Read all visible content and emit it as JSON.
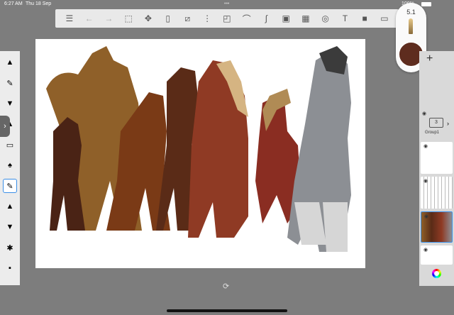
{
  "status": {
    "time": "6:27 AM",
    "date": "Thu 18 Sep",
    "battery": "100%"
  },
  "toolbar": {
    "tools": [
      {
        "name": "layers-list-icon",
        "glyph": "☰",
        "disabled": false
      },
      {
        "name": "undo-icon",
        "glyph": "←",
        "disabled": true
      },
      {
        "name": "redo-icon",
        "glyph": "→",
        "disabled": true
      },
      {
        "name": "selection-icon",
        "glyph": "⬚",
        "disabled": false
      },
      {
        "name": "move-icon",
        "glyph": "✥",
        "disabled": false
      },
      {
        "name": "fill-icon",
        "glyph": "▯",
        "disabled": false
      },
      {
        "name": "eraser-icon",
        "glyph": "⧄",
        "disabled": false
      },
      {
        "name": "symmetry-icon",
        "glyph": "⋮",
        "disabled": false
      },
      {
        "name": "shape-icon",
        "glyph": "◰",
        "disabled": false
      },
      {
        "name": "curve-icon",
        "glyph": "⌒",
        "disabled": false
      },
      {
        "name": "stroke-icon",
        "glyph": "∫",
        "disabled": false
      },
      {
        "name": "image-import-icon",
        "glyph": "▣",
        "disabled": false
      },
      {
        "name": "perspective-grid-icon",
        "glyph": "▦",
        "disabled": false
      },
      {
        "name": "lasso-icon",
        "glyph": "◎",
        "disabled": false
      },
      {
        "name": "text-icon",
        "glyph": "T",
        "disabled": false
      },
      {
        "name": "video-icon",
        "glyph": "■",
        "disabled": false
      },
      {
        "name": "frame-icon",
        "glyph": "▭",
        "disabled": false
      }
    ]
  },
  "brush": {
    "size": "5.1",
    "color": "#5e2c1e"
  },
  "layers": {
    "add": "+",
    "group": {
      "count": "3",
      "name": "Group1"
    }
  },
  "left_tools": [
    "▲",
    "✎",
    "▼",
    "▲",
    "▭",
    "♠",
    "✎",
    "▲",
    "▼",
    "✱",
    "▪"
  ]
}
